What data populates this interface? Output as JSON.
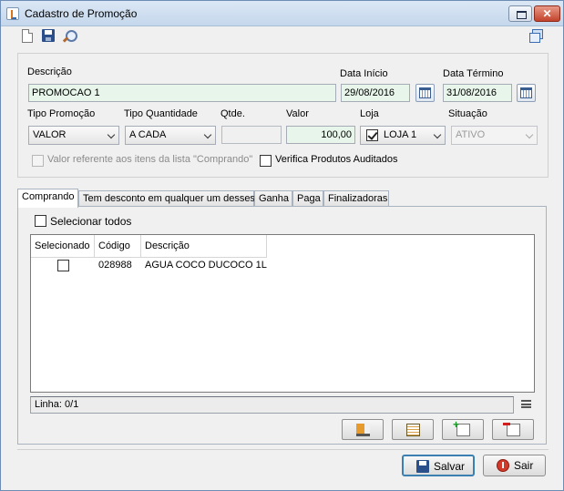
{
  "window": {
    "title": "Cadastro de Promoção"
  },
  "form": {
    "descricao_label": "Descrição",
    "descricao_value": "PROMOCAO 1",
    "data_inicio_label": "Data Início",
    "data_inicio_value": "29/08/2016",
    "data_termino_label": "Data Término",
    "data_termino_value": "31/08/2016",
    "tipo_promocao_label": "Tipo Promoção",
    "tipo_promocao_value": "VALOR",
    "tipo_quantidade_label": "Tipo Quantidade",
    "tipo_quantidade_value": "A CADA",
    "qtde_label": "Qtde.",
    "qtde_value": "",
    "valor_label": "Valor",
    "valor_value": "100,00",
    "loja_label": "Loja",
    "loja_value": "LOJA 1",
    "situacao_label": "Situação",
    "situacao_value": "ATIVO",
    "valor_referente_label": "Valor referente aos itens da lista \"Comprando\"",
    "verifica_label": "Verifica Produtos Auditados"
  },
  "tabs": [
    {
      "label": "Comprando"
    },
    {
      "label": "Tem desconto em qualquer um desses"
    },
    {
      "label": "Ganha"
    },
    {
      "label": "Paga"
    },
    {
      "label": "Finalizadoras"
    }
  ],
  "comprando": {
    "select_all_label": "Selecionar todos",
    "columns": [
      "Selecionado",
      "Código",
      "Descrição"
    ],
    "rows": [
      {
        "selected": false,
        "codigo": "028988",
        "descricao": "AGUA COCO DUCOCO 1L"
      }
    ],
    "status": "Linha: 0/1"
  },
  "footer": {
    "save_label": "Salvar",
    "exit_label": "Sair"
  }
}
